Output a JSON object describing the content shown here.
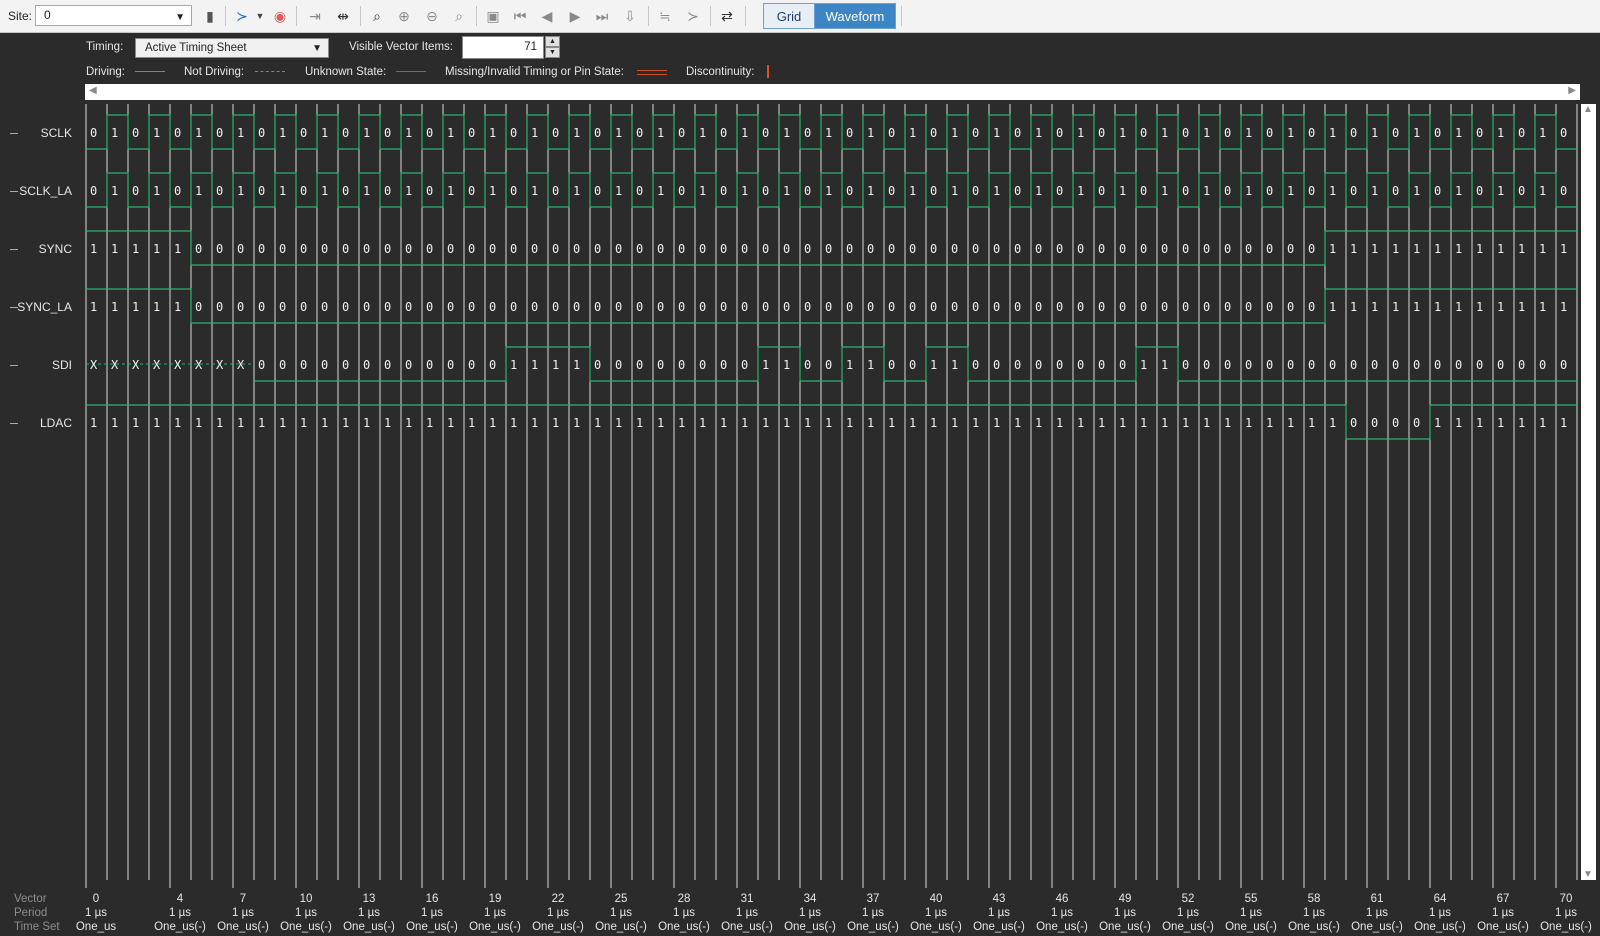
{
  "toolbar": {
    "site_label": "Site:",
    "site_value": "0",
    "grid_label": "Grid",
    "waveform_label": "Waveform"
  },
  "options": {
    "timing_label": "Timing:",
    "timing_value": "Active Timing Sheet",
    "visible_items_label": "Visible Vector Items:",
    "visible_items_value": "71"
  },
  "legend": {
    "driving": "Driving:",
    "not_driving": "Not Driving:",
    "unknown": "Unknown State:",
    "missing": "Missing/Invalid Timing or Pin State:",
    "discontinuity": "Discontinuity:"
  },
  "colors": {
    "wave": "#29b36e",
    "unknown": "#c8501e",
    "grid": "#d8d8d8",
    "background": "#2b2b2b",
    "accent": "#3d86c6"
  },
  "signals": [
    {
      "name": "SCLK",
      "pattern": "clock01"
    },
    {
      "name": "SCLK_LA",
      "pattern": "clock01"
    },
    {
      "name": "SYNC",
      "values": "11111000000000000000000000000000000000000000000000000000000111111111111"
    },
    {
      "name": "SYNC_LA",
      "values": "11111000000000000000000000000000000000000000000000000000000111111111111"
    },
    {
      "name": "SDI",
      "values": "XXXXXXXX000000000000111100000000110011001100000000110000000000000000000"
    },
    {
      "name": "LDAC",
      "values": "11111111111111111111111111111111111111111111111111111111111100001111111"
    }
  ],
  "footer": {
    "vector_label": "Vector",
    "period_label": "Period",
    "timeset_label": "Time Set",
    "vector_ticks": [
      "0",
      "4",
      "7",
      "10",
      "13",
      "16",
      "19",
      "22",
      "25",
      "28",
      "31",
      "34",
      "37",
      "40",
      "43",
      "46",
      "49",
      "52",
      "55",
      "58",
      "61",
      "64",
      "67",
      "70"
    ],
    "period_value": "1 µs",
    "timeset_first": "One_us",
    "timeset_rest": "One_us(-)"
  }
}
